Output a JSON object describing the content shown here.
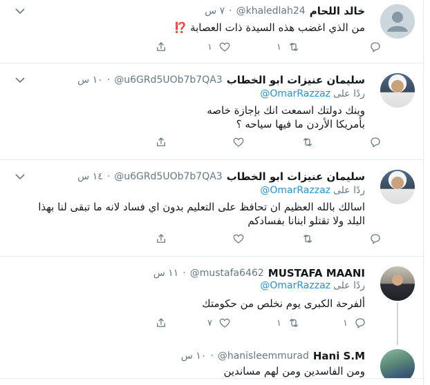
{
  "tweets": [
    {
      "name": "خالد اللحام",
      "handle": "@khaledlah24",
      "time": "٧ س",
      "text": "من الذي اغضب هذه السيدة ذات العصابة",
      "emoji": "⁉️",
      "replies": "",
      "retweets": "١",
      "likes": "١"
    },
    {
      "name": "سليمان عنيزات ابو الخطاب",
      "handle": "@u6GRd5UOb7b7QA3",
      "time": "١٠ س",
      "reply_prefix": "ردًا على",
      "reply_mention": "@OmarRazzaz",
      "text": "وينك دولتك اسمعت انك بإجازة خاصه بأمريكا الأردن ما فيها سياحه ؟",
      "replies": "",
      "retweets": "",
      "likes": ""
    },
    {
      "name": "سليمان عنيزات ابو الخطاب",
      "handle": "@u6GRd5UOb7b7QA3",
      "time": "١٤ س",
      "reply_prefix": "ردًا على",
      "reply_mention": "@OmarRazzaz",
      "text": "اسالك بالله العظيم ان تحافظ على التعليم بدون اي فساد لانه ما تبقى لنا بهذا البلد ولا تقتلو ابنانا بفسادكم",
      "replies": "",
      "retweets": "",
      "likes": ""
    },
    {
      "name": "MUSTAFA MAANI",
      "handle": "@mustafa6462",
      "time": "١١ س",
      "reply_prefix": "ردًا على",
      "reply_mention": "@OmarRazzaz",
      "text": "ألفرحة الكبرى يوم نخلص من حكومتك",
      "replies": "١",
      "retweets": "١",
      "likes": "٧"
    },
    {
      "name": "Hani S.M",
      "handle": "@hanisleemmurad",
      "time": "١٠ س",
      "text": "ومن الفاسدين ومن لهم مساندين"
    }
  ]
}
